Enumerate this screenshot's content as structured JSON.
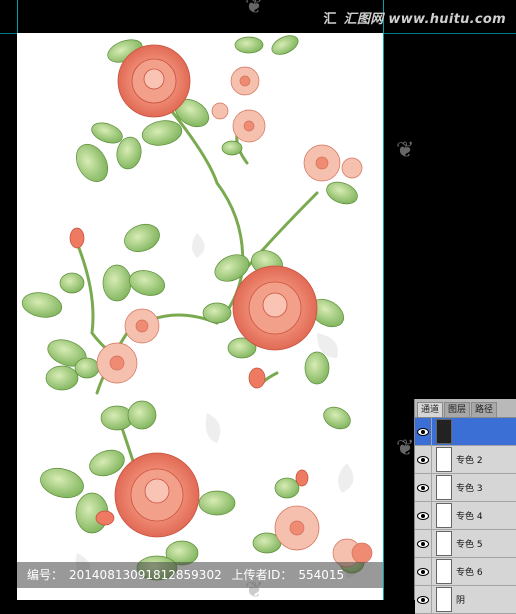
{
  "site_logo": {
    "glyph": "汇",
    "text": "汇图网 www.huitu.com"
  },
  "footer": {
    "id_label": "编号：",
    "id_value": "20140813091812859302",
    "uploader_label": "上传者ID：",
    "uploader_value": "554015"
  },
  "channels_panel": {
    "tabs": [
      "通道",
      "图层",
      "路径"
    ],
    "active_tab": 0,
    "rows": [
      {
        "label": "",
        "selected": true
      },
      {
        "label": "专色 2",
        "selected": false
      },
      {
        "label": "专色 3",
        "selected": false
      },
      {
        "label": "专色 4",
        "selected": false
      },
      {
        "label": "专色 5",
        "selected": false
      },
      {
        "label": "专色 6",
        "selected": false
      },
      {
        "label": "阴",
        "selected": false
      }
    ]
  },
  "colors": {
    "canvas_bg": "#ffffff",
    "rose": "#ef8a73",
    "leaf": "#8fc06a",
    "selection": "#3c6fd6",
    "guide": "#00c8d8"
  }
}
